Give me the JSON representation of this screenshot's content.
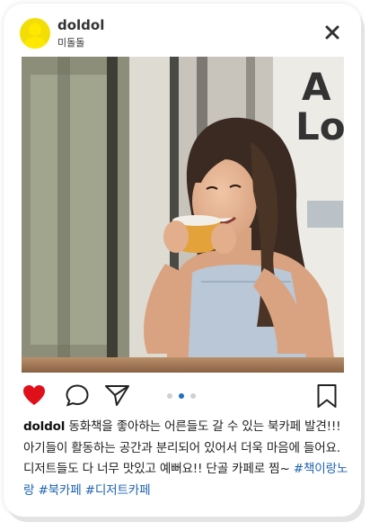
{
  "post": {
    "username": "doldol",
    "location": "미돌돌"
  },
  "caption": {
    "author": "doldol",
    "text": "동화책을 좋아하는 어른들도 갈 수 있는 북카페 발견!!! 아기들이 활동하는 공간과 분리되어 있어서 더욱 마음에 들어요. 디저트들도 다 너무 맛있고 예뻐요!! 단골 카페로 찜~",
    "hashtags": [
      "#책이랑노랑",
      "#북카페",
      "#디저트카페"
    ]
  },
  "carousel": {
    "total": 3,
    "active": 2
  },
  "state": {
    "liked": true
  },
  "icons": {
    "close": "close-icon",
    "like": "heart-icon",
    "comment": "comment-icon",
    "share": "send-icon",
    "save": "bookmark-icon"
  },
  "colors": {
    "avatar": "#f2de05",
    "like": "#e0101b",
    "hashtag": "#1e63b0",
    "active_dot": "#1e6fc0",
    "inactive_dot": "#d0d0d0"
  }
}
